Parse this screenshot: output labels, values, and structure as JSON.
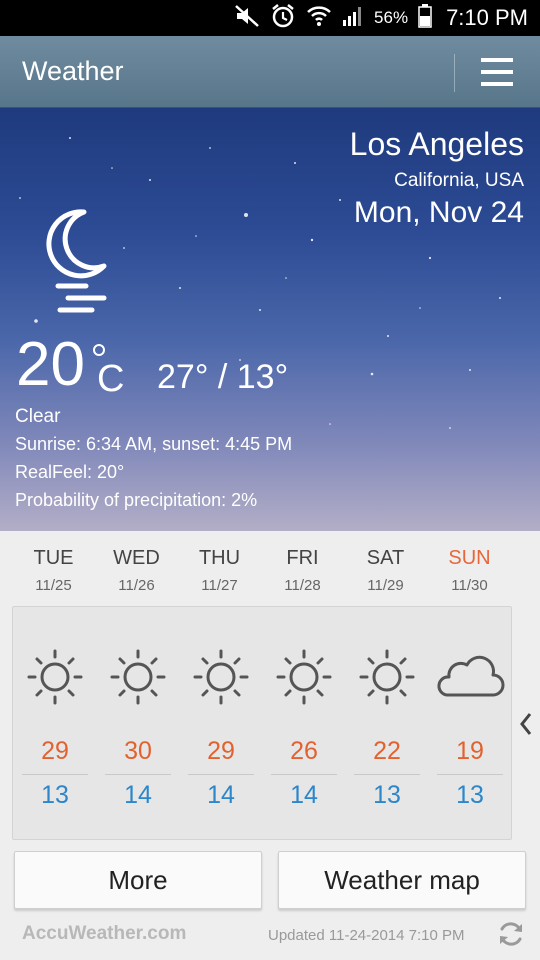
{
  "status_bar": {
    "icons": [
      "mute-icon",
      "alarm-icon",
      "wifi-icon",
      "signal-icon",
      "battery-icon"
    ],
    "battery": "56%",
    "time": "7:10 PM"
  },
  "app_bar": {
    "title": "Weather",
    "menu_icon": "hamburger-menu-icon"
  },
  "current": {
    "city": "Los Angeles",
    "region": "California, USA",
    "date": "Mon, Nov 24",
    "condition_icon": "clear-night-moon-icon",
    "temperature": "20",
    "unit": "C",
    "high_low": "27° / 13°",
    "condition": "Clear",
    "sun": "Sunrise: 6:34  AM, sunset: 4:45  PM",
    "realfeel": "RealFeel: 20°",
    "precipitation": "Probability of precipitation: 2%"
  },
  "forecast": [
    {
      "day": "TUE",
      "date": "11/25",
      "icon": "sunny-icon",
      "high": "29",
      "low": "13"
    },
    {
      "day": "WED",
      "date": "11/26",
      "icon": "sunny-icon",
      "high": "30",
      "low": "14"
    },
    {
      "day": "THU",
      "date": "11/27",
      "icon": "sunny-icon",
      "high": "29",
      "low": "14"
    },
    {
      "day": "FRI",
      "date": "11/28",
      "icon": "sunny-icon",
      "high": "26",
      "low": "14"
    },
    {
      "day": "SAT",
      "date": "11/29",
      "icon": "sunny-icon",
      "high": "22",
      "low": "13"
    },
    {
      "day": "SUN",
      "date": "11/30",
      "icon": "cloudy-icon",
      "high": "19",
      "low": "13"
    }
  ],
  "buttons": {
    "more": "More",
    "weather_map": "Weather map"
  },
  "footer": {
    "brand": "AccuWeather.com",
    "updated": "Updated 11-24-2014 7:10 PM"
  },
  "colors": {
    "app_bar": "#6a8699",
    "high_temp": "#e2622f",
    "low_temp": "#2c86c9",
    "sunday": "#e8663a"
  }
}
